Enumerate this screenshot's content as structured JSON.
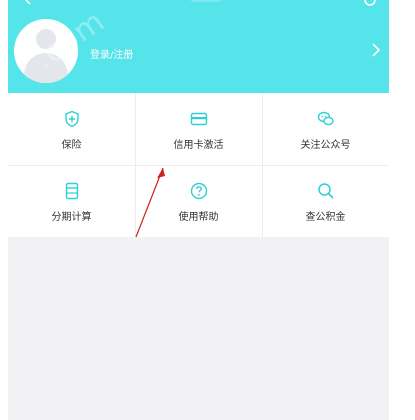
{
  "header": {
    "login_text": "登录/注册",
    "background_color": "#55e4ea"
  },
  "grid": {
    "items": [
      {
        "label": "保险",
        "icon": "shield-plus-icon"
      },
      {
        "label": "信用卡激活",
        "icon": "credit-card-icon"
      },
      {
        "label": "关注公众号",
        "icon": "wechat-icon"
      },
      {
        "label": "分期计算",
        "icon": "calculator-icon"
      },
      {
        "label": "使用帮助",
        "icon": "help-icon"
      },
      {
        "label": "查公积金",
        "icon": "search-icon"
      }
    ],
    "icon_color": "#2fcfd6"
  },
  "annotation": {
    "arrow_color": "#cc2222"
  }
}
